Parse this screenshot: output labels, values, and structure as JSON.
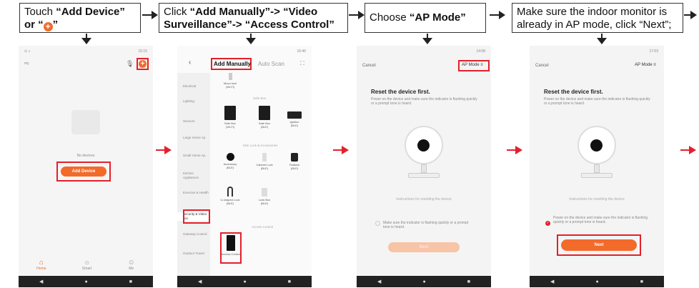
{
  "steps": [
    {
      "pre": "Touch ",
      "bold": "“Add Device”",
      "line2_bold": "or “",
      "line2_post": "”"
    },
    {
      "pre": "Click ",
      "bold1": "“Add Manually”-> “Video",
      "bold2": "Surveillance”-> “Access Control”"
    },
    {
      "pre": "Choose ",
      "bold": "“AP Mode”"
    },
    {
      "line1": "Make sure the indoor monitor is",
      "line2": "already in AP mode, click “Next”;"
    }
  ],
  "phone1": {
    "time": "15:15",
    "home_name": "my",
    "empty_text": "No devices",
    "add_button": "Add Device",
    "tabs": [
      "Home",
      "Smart",
      "Me"
    ]
  },
  "phone2": {
    "time": "16:46",
    "tab_manual": "Add Manually",
    "tab_auto": "Auto Scan",
    "sidebar": [
      "Electrical",
      "Lighting",
      "Sensors",
      "Large Home Ap.",
      "Small Home Ap.",
      "Kitchen Appliances",
      "Exercise & Health",
      "Security & Video Sur.",
      "Gateway Control",
      "Outdoor Travel"
    ],
    "top_device": {
      "name": "Moon lock",
      "sub": "(Wi-Fi)"
    },
    "section_safe": "Safe Box",
    "safe_devices": [
      {
        "name": "Safe Box",
        "sub": "(Wi-Fi)"
      },
      {
        "name": "Safe Box",
        "sub": "(BLE)"
      },
      {
        "name": "Ignition",
        "sub": "(BLE)"
      }
    ],
    "section_lock": "Mini Lock & Accessories",
    "lock_devices": [
      {
        "name": "Accessory",
        "sub": "(BLE)"
      },
      {
        "name": "Cabinet Lock",
        "sub": "(BLE)"
      },
      {
        "name": "Padlock",
        "sub": "(BLE)"
      },
      {
        "name": "U-shaped Lock",
        "sub": "(BLE)"
      },
      {
        "name": "Lock Box",
        "sub": "(BLE)"
      }
    ],
    "section_access": "Access Control",
    "access_device": {
      "name": "Access Control"
    }
  },
  "phone3": {
    "time": "14:08",
    "cancel": "Cancel",
    "mode": "AP Mode",
    "title": "Reset the device first.",
    "desc": "Power on the device and make sure the indicator is flashing quickly or a prompt tone is heard.",
    "reset_link": "Instructions for resetting the device",
    "confirm": "Make sure the indicator is flashing quickly or a prompt tone is heard.",
    "next": "Next"
  },
  "phone4": {
    "time": "17:03",
    "cancel": "Cancel",
    "mode": "AP Mode",
    "title": "Reset the device first.",
    "desc": "Power on the device and make sure the indicator is flashing quickly or a prompt tone is heard.",
    "reset_link": "Instructions for resetting the device",
    "confirm": "Power on the device and make sure the indicator is flashing quickly or a prompt tone is heard.",
    "next": "Next"
  }
}
